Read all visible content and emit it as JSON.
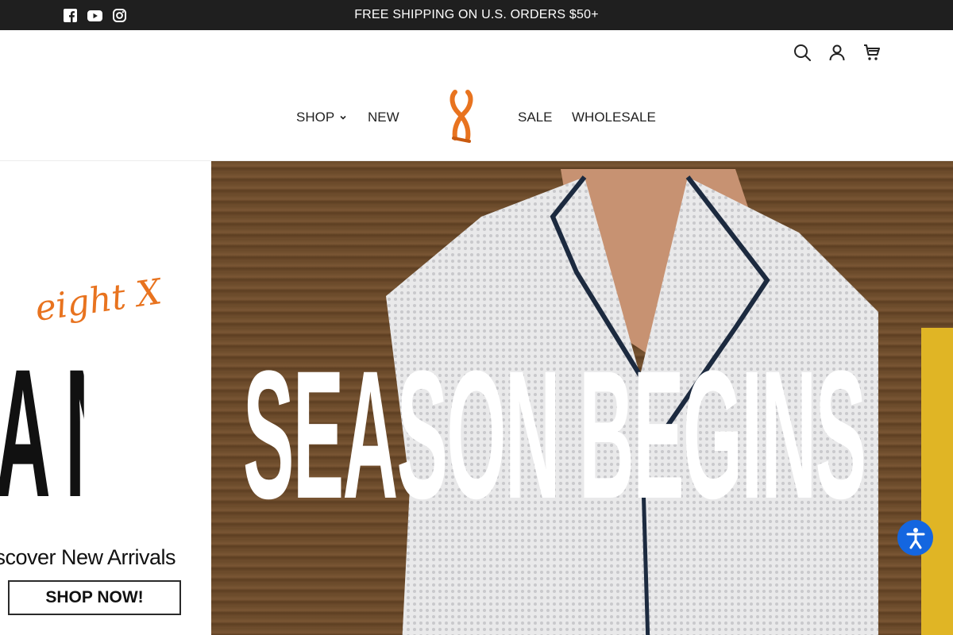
{
  "announcement": {
    "text": "FREE SHIPPING ON U.S. ORDERS $50+",
    "social_icons": [
      "facebook-icon",
      "youtube-icon",
      "instagram-icon"
    ]
  },
  "header": {
    "utility_icons": [
      "search-icon",
      "account-icon",
      "cart-icon"
    ],
    "nav": {
      "shop": "SHOP",
      "new": "NEW",
      "sale": "SALE",
      "wholesale": "WHOLESALE"
    },
    "logo_color": "#e8731f"
  },
  "hero": {
    "brand": "eight X",
    "headline_left": "A NEW",
    "headline_right": "SEASON BEGINS",
    "subline": "iscover New Arrivals",
    "cta": "SHOP NOW!"
  },
  "colors": {
    "topbar": "#1f1f1f",
    "accent": "#e8731f",
    "a11y": "#1466e0"
  }
}
